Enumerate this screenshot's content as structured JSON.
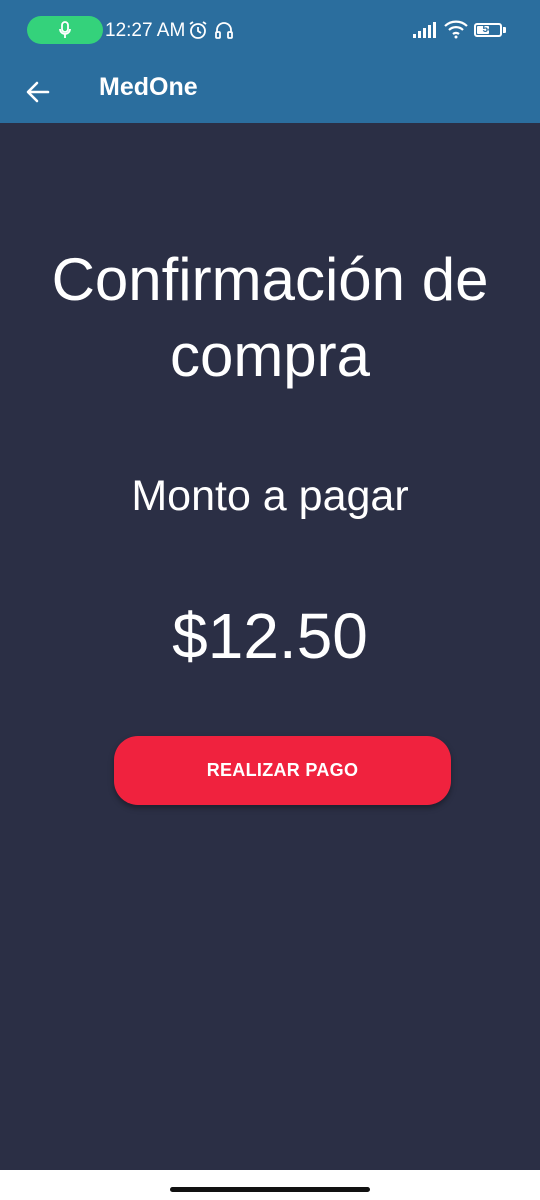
{
  "status_bar": {
    "time": "12:27 AM",
    "battery_level": "54",
    "battery_fraction": 0.54,
    "icons": [
      "microphone-icon",
      "alarm-icon",
      "headset-icon",
      "signal-icon",
      "wifi-icon",
      "battery-icon"
    ],
    "mic_pill_color": "#34d27b"
  },
  "toolbar": {
    "title": "MedOne",
    "background": "#2b6e9e",
    "back_icon": "arrow-left-icon"
  },
  "main": {
    "heading": "Confirmación de compra",
    "amount_label": "Monto a pagar",
    "amount_value": "$12.50",
    "background": "#2b2f45"
  },
  "actions": {
    "pay_label": "REALIZAR PAGO",
    "pay_color": "#f0223e"
  }
}
